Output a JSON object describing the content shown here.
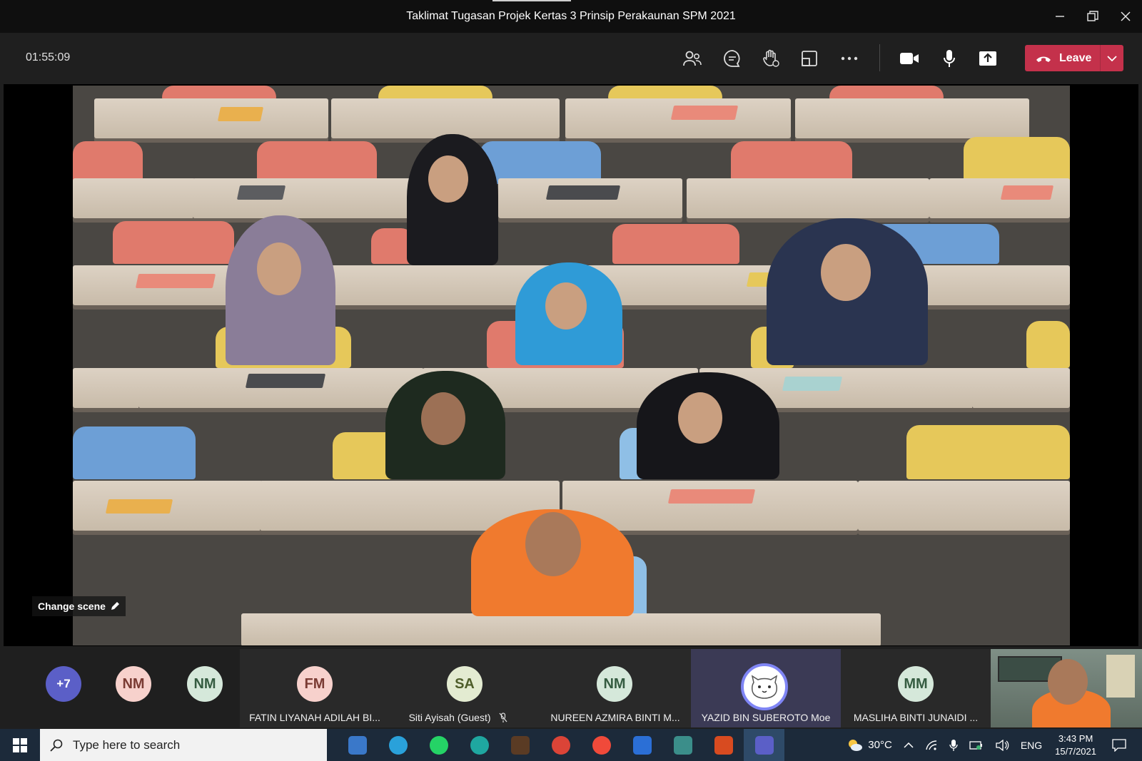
{
  "window": {
    "title": "Taklimat Tugasan Projek Kertas 3 Prinsip Perakaunan SPM 2021"
  },
  "toolbar": {
    "timer": "01:55:09",
    "icons": [
      "participants-icon",
      "chat-icon",
      "raise-hand-icon",
      "rooms-icon",
      "more-icon",
      "camera-icon",
      "mic-icon",
      "share-icon"
    ],
    "leave_label": "Leave"
  },
  "stage": {
    "change_scene_label": "Change scene"
  },
  "participants": {
    "overflow": "+7",
    "avatars": [
      {
        "initials": "NM",
        "bg": "#f7d1cc",
        "fg": "#7a3b33"
      },
      {
        "initials": "NM",
        "bg": "#d5e8da",
        "fg": "#355c41"
      }
    ],
    "tiles": [
      {
        "initials": "FM",
        "name": "FATIN LIYANAH ADILAH BI...",
        "bg": "#f7d1cc",
        "fg": "#7a3b33"
      },
      {
        "initials": "SA",
        "name": "Siti Ayisah (Guest)",
        "bg": "#e3ebd1",
        "fg": "#4f5e2b"
      },
      {
        "initials": "NM",
        "name": "NUREEN AZMIRA BINTI M...",
        "bg": "#d5e8da",
        "fg": "#355c41"
      },
      {
        "initials": "",
        "name": "YAZID BIN SUBEROTO Moe",
        "bg": "#ffffff",
        "fg": "#333333"
      },
      {
        "initials": "MM",
        "name": "MASLIHA BINTI JUNAIDI ...",
        "bg": "#d5e8da",
        "fg": "#355c41"
      }
    ]
  },
  "taskbar": {
    "search_placeholder": "Type here to search",
    "weather": "30°C",
    "language": "ENG",
    "time": "3:43 PM",
    "date": "15/7/2021"
  },
  "colors": {
    "leave": "#c4314b",
    "active_tile": "#3b3a55",
    "taskbar": "#1c2a3a"
  }
}
